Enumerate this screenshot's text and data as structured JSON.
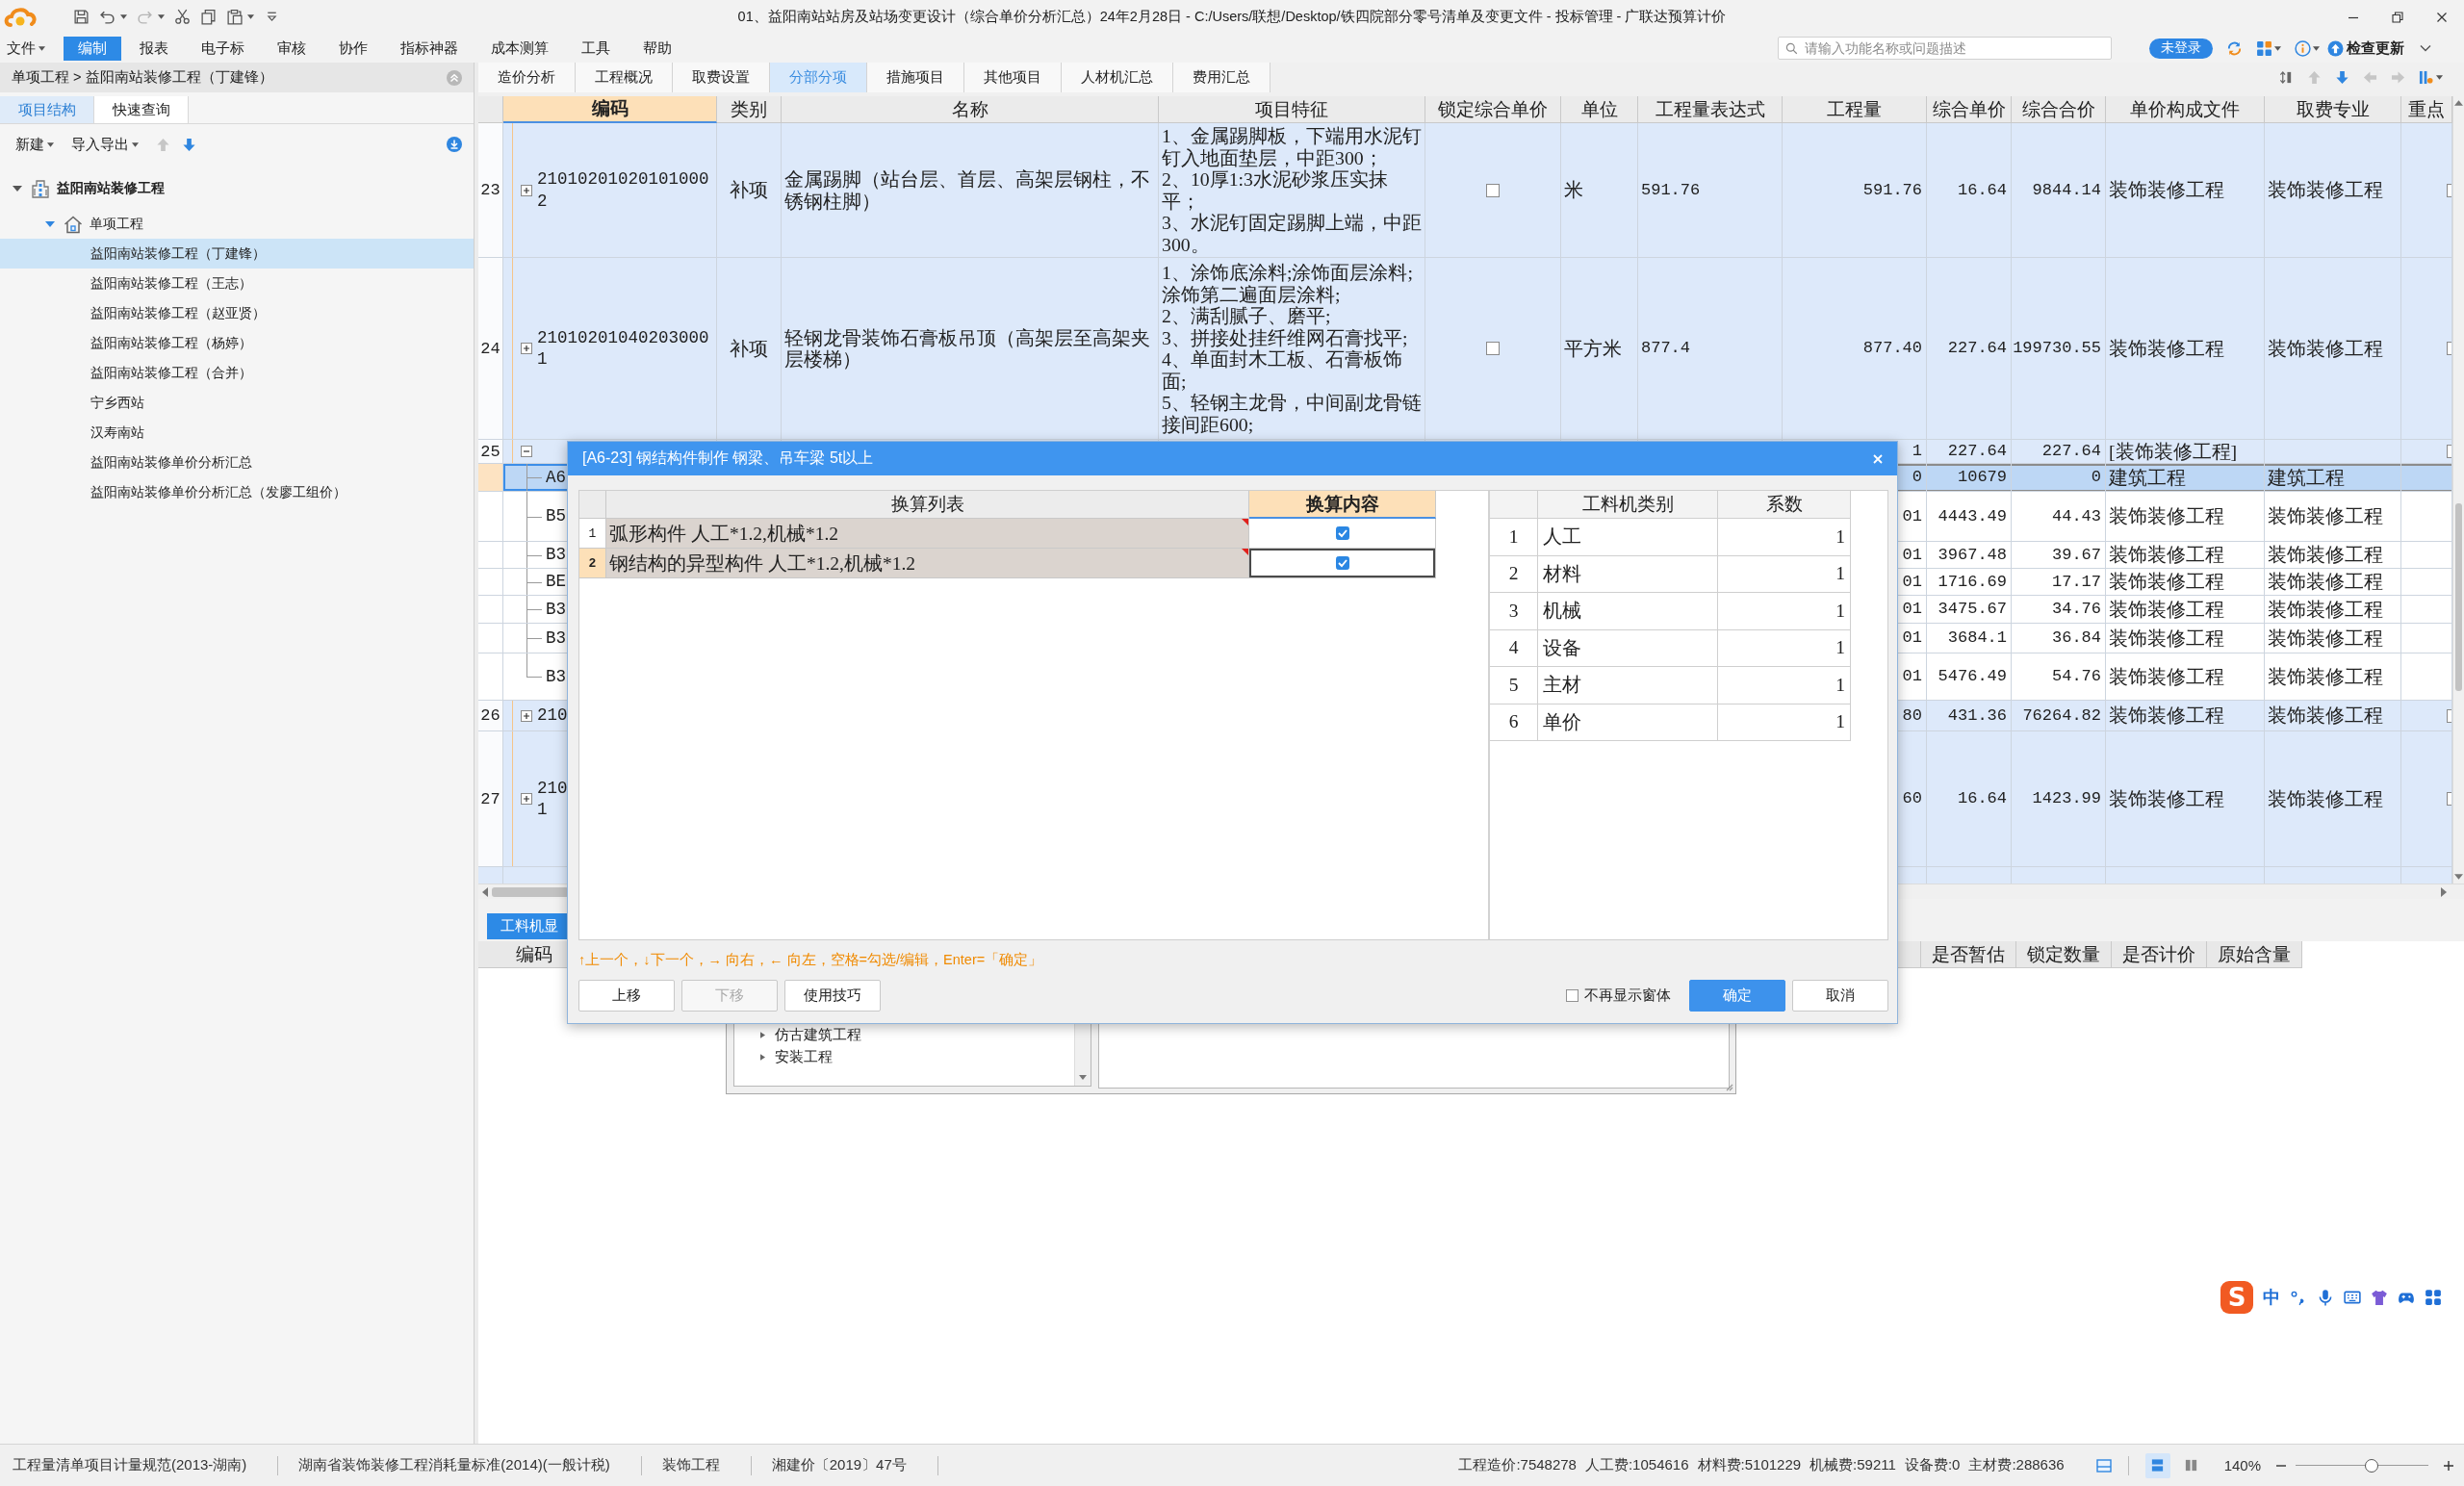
{
  "window": {
    "title": "01、益阳南站站房及站场变更设计（综合单价分析汇总）24年2月28日 - C:/Users/联想/Desktop/铁四院部分零号清单及变更文件 - 投标管理 - 广联达预算计价"
  },
  "menu": [
    {
      "label": "文件",
      "selected": false,
      "caret": true
    },
    {
      "label": "编制",
      "selected": true,
      "caret": false
    },
    {
      "label": "报表",
      "selected": false,
      "caret": false
    },
    {
      "label": "电子标",
      "selected": false,
      "caret": false
    },
    {
      "label": "审核",
      "selected": false,
      "caret": false
    },
    {
      "label": "协作",
      "selected": false,
      "caret": false
    },
    {
      "label": "指标神器",
      "selected": false,
      "caret": false
    },
    {
      "label": "成本测算",
      "selected": false,
      "caret": false
    },
    {
      "label": "工具",
      "selected": false,
      "caret": false
    },
    {
      "label": "帮助",
      "selected": false,
      "caret": false
    }
  ],
  "search": {
    "placeholder": "请输入功能名称或问题描述"
  },
  "account": {
    "login_button": "未登录",
    "update_button": "检查更新"
  },
  "breadcrumb": "单项工程 > 益阳南站装修工程（丁建锋）",
  "side_tabs": [
    {
      "label": "项目结构",
      "selected": true
    },
    {
      "label": "快速查询",
      "selected": false
    }
  ],
  "side_toolbar": {
    "buttons": [
      "新建",
      "导入导出"
    ],
    "move_buttons": [
      {
        "kind": "up",
        "disabled": true
      },
      {
        "kind": "down",
        "disabled": false
      }
    ]
  },
  "tree": [
    {
      "label": "益阳南站装修工程",
      "kind": "project",
      "expanded": true,
      "selected": false,
      "children": [
        {
          "label": "单项工程",
          "kind": "group",
          "expanded": true,
          "selected": false,
          "children": [
            {
              "label": "益阳南站装修工程（丁建锋）",
              "selected": true
            },
            {
              "label": "益阳南站装修工程（王志）",
              "selected": false
            },
            {
              "label": "益阳南站装修工程（赵亚贤）",
              "selected": false
            },
            {
              "label": "益阳南站装修工程（杨婷）",
              "selected": false
            },
            {
              "label": "益阳南站装修工程（合并）",
              "selected": false
            },
            {
              "label": "宁乡西站",
              "selected": false
            },
            {
              "label": "汉寿南站",
              "selected": false
            },
            {
              "label": "益阳南站装修单价分析汇总",
              "selected": false
            },
            {
              "label": "益阳南站装修单价分析汇总（发廖工组价）",
              "selected": false
            }
          ]
        }
      ]
    }
  ],
  "main_tabs": [
    {
      "label": "造价分析",
      "selected": false
    },
    {
      "label": "工程概况",
      "selected": false
    },
    {
      "label": "取费设置",
      "selected": false
    },
    {
      "label": "分部分项",
      "selected": true
    },
    {
      "label": "措施项目",
      "selected": false
    },
    {
      "label": "其他项目",
      "selected": false
    },
    {
      "label": "人材机汇总",
      "selected": false
    },
    {
      "label": "费用汇总",
      "selected": false
    }
  ],
  "nav_buttons": [
    {
      "kind": "up",
      "disabled": true
    },
    {
      "kind": "down",
      "disabled": false
    },
    {
      "kind": "left",
      "disabled": true
    },
    {
      "kind": "right",
      "disabled": true
    }
  ],
  "table": {
    "columns": [
      {
        "label": "编码",
        "selected": true
      },
      {
        "label": "类别",
        "selected": false
      },
      {
        "label": "名称",
        "selected": false
      },
      {
        "label": "项目特征",
        "selected": false
      },
      {
        "label": "锁定综合单价",
        "selected": false
      },
      {
        "label": "单位",
        "selected": false
      },
      {
        "label": "工程量表达式",
        "selected": false
      },
      {
        "label": "工程量",
        "selected": false
      },
      {
        "label": "综合单价",
        "selected": false
      },
      {
        "label": "综合合价",
        "selected": false
      },
      {
        "label": "单价构成文件",
        "selected": false
      },
      {
        "label": "取费专业",
        "selected": false
      },
      {
        "label": "重点",
        "selected": false
      }
    ],
    "rows": [
      {
        "kind": "item",
        "number": "23",
        "expanded": false,
        "code": "210102010201010002",
        "category": "补项",
        "name": "金属踢脚（站台层、首层、高架层钢柱，不锈钢柱脚）",
        "features": "1、金属踢脚板，下端用水泥钉钉入地面垫层，中距300；\n2、10厚1:3水泥砂浆压实抹平；\n3、水泥钉固定踢脚上端，中距300。",
        "locked": false,
        "unit": "米",
        "expression": "591.76",
        "quantity": "591.76",
        "unit_price": "16.64",
        "total": "9844.14",
        "price_file": "装饰装修工程",
        "fee_type": "装饰装修工程",
        "key": false,
        "selected": false
      },
      {
        "kind": "item",
        "number": "24",
        "expanded": false,
        "code": "210102010402030001",
        "category": "补项",
        "name": "轻钢龙骨装饰石膏板吊顶（高架层至高架夹层楼梯）",
        "features": "1、涂饰底涂料;涂饰面层涂料;涂饰第二遍面层涂料;\n2、满刮腻子、磨平;\n3、拼接处挂纤维网石膏找平;\n4、单面封木工板、石膏板饰面;\n5、轻钢主龙骨，中间副龙骨链接间距600;",
        "locked": false,
        "unit": "平方米",
        "expression": "877.4",
        "quantity": "877.40",
        "unit_price": "227.64",
        "total": "199730.55",
        "price_file": "装饰装修工程",
        "fee_type": "装饰装修工程",
        "key": false,
        "selected": false
      },
      {
        "kind": "item",
        "number": "25",
        "expanded": true,
        "quantity": "1",
        "unit_price": "227.64",
        "total": "227.64",
        "price_file": "[装饰装修工程]",
        "key": false,
        "selected": false
      },
      {
        "kind": "sub",
        "code": "A6",
        "quantity": "0",
        "unit_price": "10679",
        "total": "0",
        "price_file": "建筑工程",
        "fee_type": "建筑工程",
        "selected": true
      },
      {
        "kind": "sub",
        "code": "B5",
        "quantity": "01",
        "unit_price": "4443.49",
        "total": "44.43",
        "price_file": "装饰装修工程",
        "fee_type": "装饰装修工程",
        "selected": false
      },
      {
        "kind": "sub",
        "code": "B3",
        "quantity": "01",
        "unit_price": "3967.48",
        "total": "39.67",
        "price_file": "装饰装修工程",
        "fee_type": "装饰装修工程",
        "selected": false
      },
      {
        "kind": "sub",
        "code": "BE",
        "quantity": "01",
        "unit_price": "1716.69",
        "total": "17.17",
        "price_file": "装饰装修工程",
        "fee_type": "装饰装修工程",
        "selected": false
      },
      {
        "kind": "sub",
        "code": "B3",
        "quantity": "01",
        "unit_price": "3475.67",
        "total": "34.76",
        "price_file": "装饰装修工程",
        "fee_type": "装饰装修工程",
        "selected": false
      },
      {
        "kind": "sub",
        "code": "B3",
        "quantity": "01",
        "unit_price": "3684.1",
        "total": "36.84",
        "price_file": "装饰装修工程",
        "fee_type": "装饰装修工程",
        "selected": false
      },
      {
        "kind": "sub",
        "code": "B3",
        "quantity": "01",
        "unit_price": "5476.49",
        "total": "54.76",
        "price_file": "装饰装修工程",
        "fee_type": "装饰装修工程",
        "selected": false
      },
      {
        "kind": "item",
        "number": "26",
        "expanded": false,
        "code": "210",
        "quantity": "80",
        "unit_price": "431.36",
        "total": "76264.82",
        "price_file": "装饰装修工程",
        "fee_type": "装饰装修工程",
        "key": false,
        "selected": false
      },
      {
        "kind": "item",
        "number": "27",
        "expanded": false,
        "code": "210\n1",
        "quantity": "60",
        "unit_price": "16.64",
        "total": "1423.99",
        "price_file": "装饰装修工程",
        "fee_type": "装饰装修工程",
        "key": false,
        "selected": false
      }
    ]
  },
  "detail_panel": {
    "tabs": [
      {
        "label": "工料机显",
        "selected": true
      }
    ],
    "left_columns": [
      "编码"
    ],
    "right_columns": [
      "是否暂估",
      "锁定数量",
      "是否计价",
      "原始含量"
    ]
  },
  "back_panel": {
    "items": [
      {
        "label": "仿古建筑工程",
        "expanded": false
      },
      {
        "label": "安装工程",
        "expanded": false
      }
    ]
  },
  "dialog": {
    "title": "[A6-23] 钢结构件制作 钢梁、吊车梁 5t以上",
    "conversions": {
      "columns": [
        {
          "label": "换算列表",
          "selected": false
        },
        {
          "label": "换算内容",
          "selected": true
        }
      ],
      "rows": [
        {
          "number": "1",
          "text": "弧形构件 人工*1.2,机械*1.2",
          "checked": true,
          "selected": false
        },
        {
          "number": "2",
          "text": "钢结构的异型构件 人工*1.2,机械*1.2",
          "checked": true,
          "selected": true
        }
      ]
    },
    "factors": {
      "columns": [
        "工料机类别",
        "系数"
      ],
      "rows": [
        {
          "number": "1",
          "category": "人工",
          "value": "1"
        },
        {
          "number": "2",
          "category": "材料",
          "value": "1"
        },
        {
          "number": "3",
          "category": "机械",
          "value": "1"
        },
        {
          "number": "4",
          "category": "设备",
          "value": "1"
        },
        {
          "number": "5",
          "category": "主材",
          "value": "1"
        },
        {
          "number": "6",
          "category": "单价",
          "value": "1"
        }
      ]
    },
    "hint": "↑上一个，↓下一个，→ 向右，← 向左，空格=勾选/编辑，Enter=「确定」",
    "left_buttons": [
      {
        "label": "上移",
        "disabled": false
      },
      {
        "label": "下移",
        "disabled": true
      },
      {
        "label": "使用技巧",
        "disabled": false
      }
    ],
    "dont_show_again": {
      "label": "不再显示窗体",
      "checked": false
    },
    "right_buttons": [
      {
        "label": "确定",
        "kind": "primary"
      },
      {
        "label": "取消",
        "kind": "default"
      }
    ]
  },
  "status_bar": {
    "items": [
      "工程量清单项目计量规范(2013-湖南)",
      "湖南省装饰装修工程消耗量标准(2014)(一般计税)",
      "装饰工程",
      "湘建价〔2019〕47号"
    ],
    "totals": [
      "工程造价:7548278",
      "人工费:1054616",
      "材料费:5101229",
      "机械费:59211",
      "设备费:0",
      "主材费:288636"
    ],
    "view_buttons": [
      {
        "kind": "rows",
        "selected": true
      },
      {
        "kind": "columns",
        "selected": false
      }
    ],
    "zoom": "140%",
    "zoom_slider": {
      "level": 0.57
    }
  },
  "ime": {
    "logo": "S",
    "mode": "中"
  }
}
